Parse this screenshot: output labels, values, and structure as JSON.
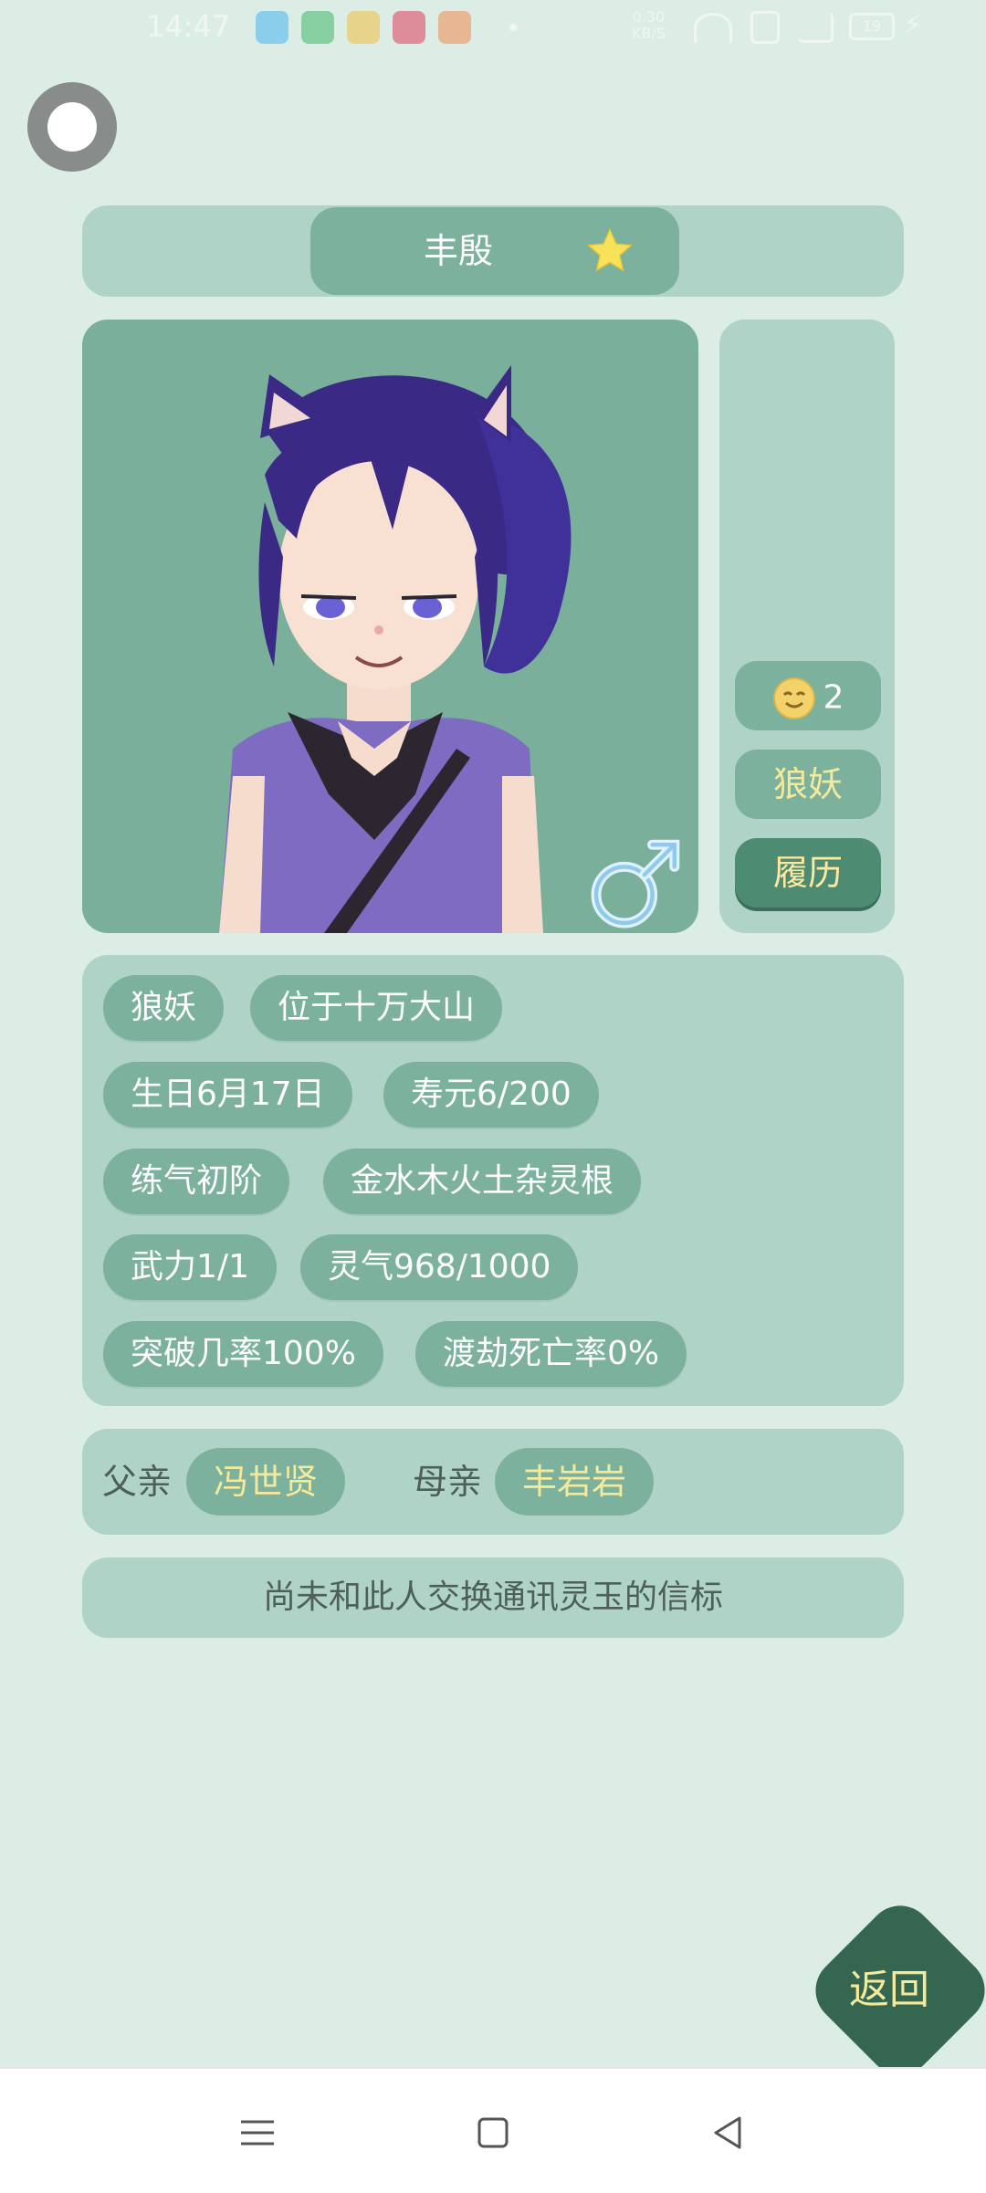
{
  "status_bar": {
    "time": "14:47",
    "net_speed_value": "0.30",
    "net_speed_unit": "KB/S",
    "battery": "19",
    "app_icons": [
      "qq-icon",
      "wechat-app-icon",
      "weibo-icon",
      "heart-app-icon",
      "game-app-icon"
    ]
  },
  "character": {
    "name": "丰殷",
    "favorite": true,
    "gender": "male",
    "mood_value": "2",
    "race_button": "狼妖",
    "history_button": "履历"
  },
  "info_tags": {
    "race": "狼妖",
    "location": "位于十万大山",
    "birthday": "生日6月17日",
    "lifespan": "寿元6/200",
    "realm": "练气初阶",
    "spirit_root": "金水木火土杂灵根",
    "force": "武力1/1",
    "qi": "灵气968/1000",
    "breakthrough": "突破几率100%",
    "tribulation": "渡劫死亡率0%"
  },
  "parents": {
    "father_label": "父亲",
    "father_name": "冯世贤",
    "mother_label": "母亲",
    "mother_name": "丰岩岩"
  },
  "jade_message": "尚未和此人交换通讯灵玉的信标",
  "back_button": "返回",
  "colors": {
    "background": "#dcede6",
    "panel": "#afd3c7",
    "pill": "#7bb19d",
    "accent_text": "#f5e99b",
    "back_button": "#356650"
  }
}
